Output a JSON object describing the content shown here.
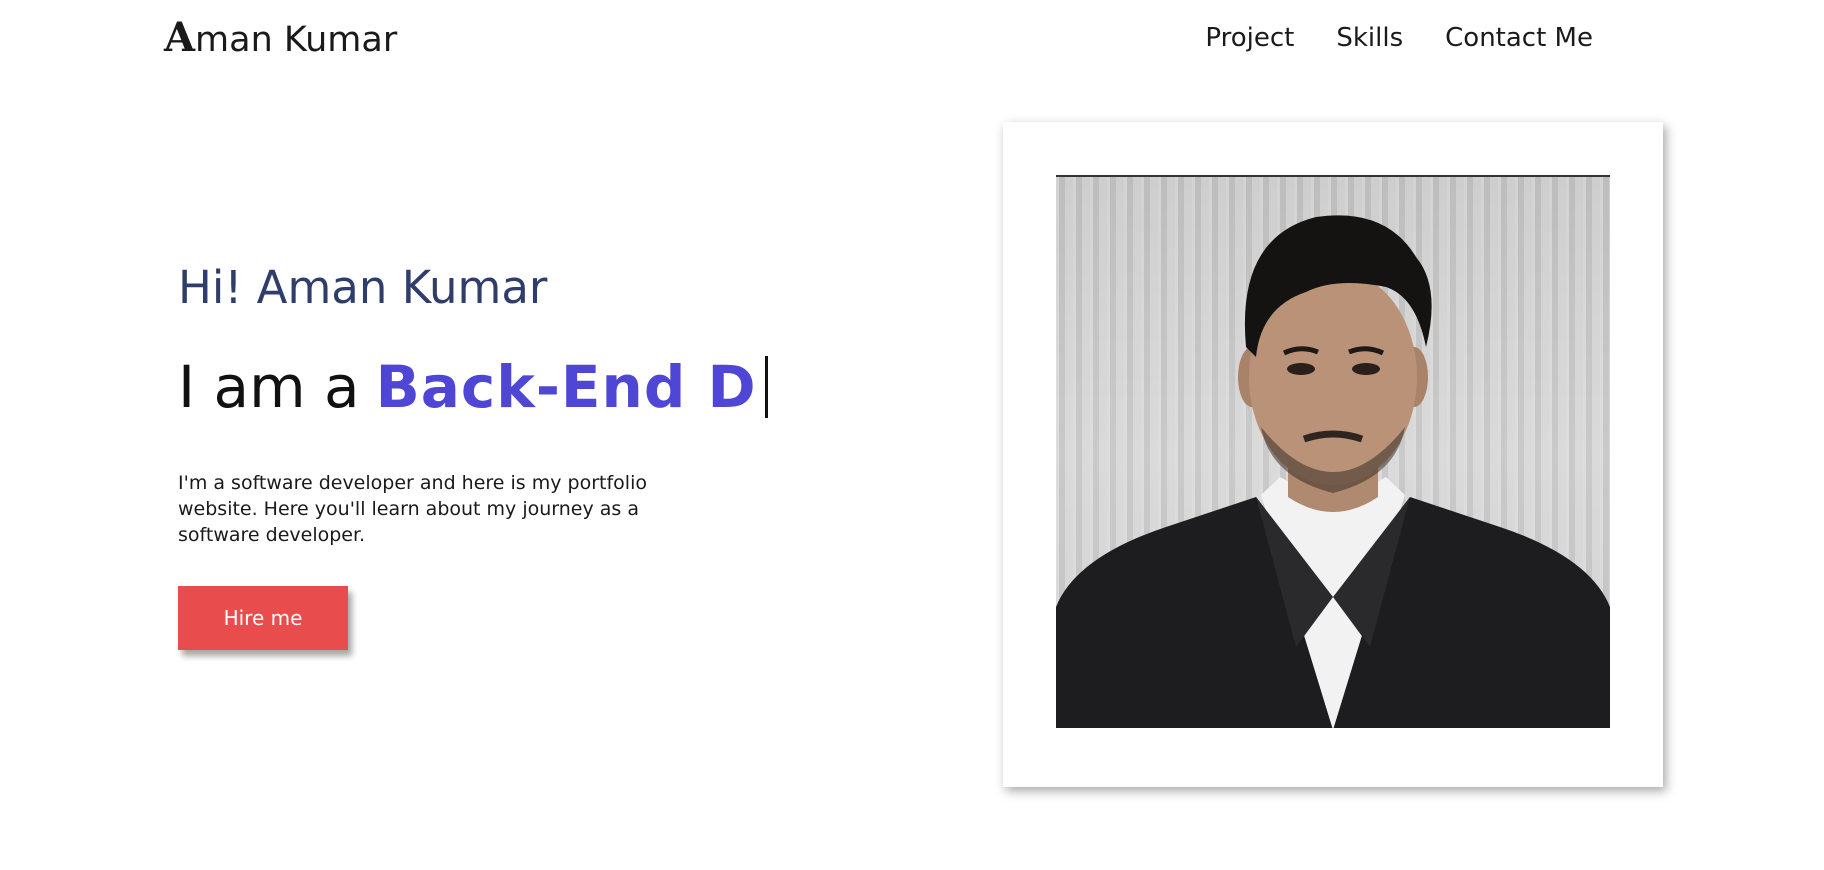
{
  "header": {
    "logo_initial": "A",
    "logo_rest": "man Kumar",
    "nav": [
      {
        "label": "Project"
      },
      {
        "label": "Skills"
      },
      {
        "label": "Contact Me"
      }
    ]
  },
  "hero": {
    "greeting": "Hi! Aman Kumar",
    "tagline_prefix": "I am a",
    "typed_role": "Back-End D",
    "bio": "I'm a software developer and here is my portfolio website. Here you'll learn about my journey as a software developer.",
    "hire_button": "Hire me"
  },
  "colors": {
    "accent": "#4f46d6",
    "greeting": "#2f3d6b",
    "button": "#e84c4c"
  },
  "icons": {
    "photo": "portrait-photo"
  }
}
